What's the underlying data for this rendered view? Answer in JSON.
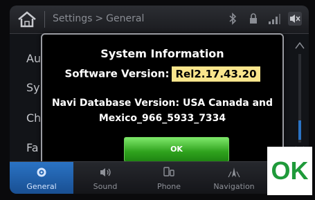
{
  "header": {
    "breadcrumb_root": "Settings",
    "breadcrumb_separator": ">",
    "breadcrumb_current": "General"
  },
  "background_list": {
    "items": [
      "Au",
      "Sy",
      "Ch",
      "Fa"
    ]
  },
  "dialog": {
    "title": "System Information",
    "software_label": "Software Version:",
    "software_value": "Rel2.17.43.20",
    "navi_line1": "Navi Database Version: USA Canada and",
    "navi_line2": "Mexico_966_5933_7334",
    "ok_label": "OK"
  },
  "tabs": [
    {
      "label": "General",
      "icon": "gear-icon",
      "active": true
    },
    {
      "label": "Sound",
      "icon": "speaker-icon",
      "active": false
    },
    {
      "label": "Phone",
      "icon": "phone-icon",
      "active": false
    },
    {
      "label": "Navigation",
      "icon": "navigation-icon",
      "active": false
    }
  ],
  "overlay": {
    "ok_text": "OK"
  },
  "colors": {
    "highlight": "#f9e58c",
    "ok_button": "#2fa21d",
    "active_tab": "#2a73c4",
    "ok_overlay_text": "#1f9a3a"
  }
}
